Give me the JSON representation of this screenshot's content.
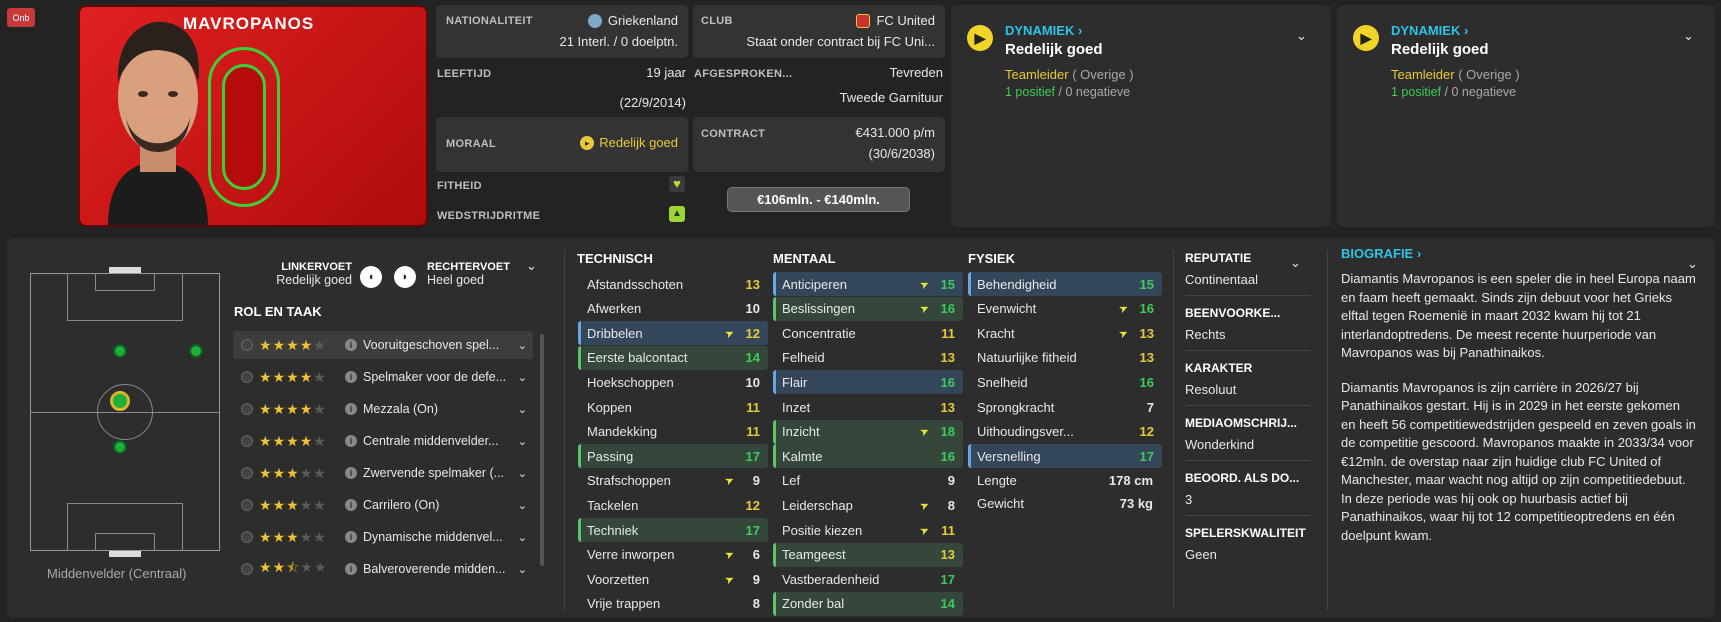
{
  "badge": "Onb",
  "player": {
    "name": "MAVROPANOS"
  },
  "info": {
    "nationality_label": "NATIONALITEIT",
    "nationality": "Griekenland",
    "caps": "21 Interl. / 0 doelptn.",
    "club_label": "CLUB",
    "club": "FC United",
    "club_status": "Staat onder contract bij FC Uni...",
    "age_label": "LEEFTIJD",
    "age": "19 jaar",
    "dob": "(22/9/2014)",
    "agreed_label": "AFGESPROKEN...",
    "agreed": "Tevreden",
    "squad_status": "Tweede Garnituur",
    "morale_label": "MORAAL",
    "morale": "Redelijk goed",
    "contract_label": "CONTRACT",
    "wage": "€431.000 p/m",
    "contract_end": "(30/6/2038)",
    "fitness_label": "FITHEID",
    "match_label": "WEDSTRIJDRITME",
    "value": "€106mln. - €140mln."
  },
  "dynamics": [
    {
      "title": "DYNAMIEK ›",
      "status": "Redelijk goed",
      "role": "Teamleider",
      "role_group": "( Overige )",
      "positive": "1 positief",
      "sep": "/",
      "negative": "0 negatieve"
    },
    {
      "title": "DYNAMIEK ›",
      "status": "Redelijk goed",
      "role": "Teamleider",
      "role_group": "( Overige )",
      "positive": "1 positief",
      "sep": "/",
      "negative": "0 negatieve"
    }
  ],
  "feet": {
    "left_label": "LINKERVOET",
    "left_value": "Redelijk goed",
    "right_label": "RECHTERVOET",
    "right_value": "Heel goed"
  },
  "roles_title": "ROL EN TAAK",
  "position_label": "Middenvelder (Centraal)",
  "roles": [
    {
      "stars": 4,
      "half": false,
      "label": "Vooruitgeschoven spel..."
    },
    {
      "stars": 4,
      "half": false,
      "label": "Spelmaker voor de defe..."
    },
    {
      "stars": 4,
      "half": false,
      "label": "Mezzala (On)"
    },
    {
      "stars": 4,
      "half": false,
      "label": "Centrale middenvelder..."
    },
    {
      "stars": 3,
      "half": false,
      "label": "Zwervende spelmaker (..."
    },
    {
      "stars": 3,
      "half": false,
      "label": "Carrilero (On)"
    },
    {
      "stars": 3,
      "half": false,
      "label": "Dynamische middenvel..."
    },
    {
      "stars": 2,
      "half": true,
      "label": "Balveroverende midden..."
    }
  ],
  "technical_title": "TECHNISCH",
  "technical": [
    {
      "name": "Afstandsschoten",
      "value": "13",
      "hl": "none",
      "arrow": false
    },
    {
      "name": "Afwerken",
      "value": "10",
      "hl": "none",
      "arrow": false
    },
    {
      "name": "Dribbelen",
      "value": "12",
      "hl": "blue",
      "arrow": true
    },
    {
      "name": "Eerste balcontact",
      "value": "14",
      "hl": "green",
      "arrow": false
    },
    {
      "name": "Hoekschoppen",
      "value": "10",
      "hl": "none",
      "arrow": false
    },
    {
      "name": "Koppen",
      "value": "11",
      "hl": "none",
      "arrow": false
    },
    {
      "name": "Mandekking",
      "value": "11",
      "hl": "none",
      "arrow": false
    },
    {
      "name": "Passing",
      "value": "17",
      "hl": "green",
      "arrow": false
    },
    {
      "name": "Strafschoppen",
      "value": "9",
      "hl": "none",
      "arrow": true
    },
    {
      "name": "Tackelen",
      "value": "12",
      "hl": "none",
      "arrow": false
    },
    {
      "name": "Techniek",
      "value": "17",
      "hl": "green",
      "arrow": false
    },
    {
      "name": "Verre inworpen",
      "value": "6",
      "hl": "none",
      "arrow": true
    },
    {
      "name": "Voorzetten",
      "value": "9",
      "hl": "none",
      "arrow": true
    },
    {
      "name": "Vrije trappen",
      "value": "8",
      "hl": "none",
      "arrow": false
    }
  ],
  "mental_title": "MENTAAL",
  "mental": [
    {
      "name": "Anticiperen",
      "value": "15",
      "hl": "blue",
      "arrow": true
    },
    {
      "name": "Beslissingen",
      "value": "16",
      "hl": "green",
      "arrow": true
    },
    {
      "name": "Concentratie",
      "value": "11",
      "hl": "none",
      "arrow": false
    },
    {
      "name": "Felheid",
      "value": "13",
      "hl": "none",
      "arrow": false
    },
    {
      "name": "Flair",
      "value": "16",
      "hl": "blue",
      "arrow": false
    },
    {
      "name": "Inzet",
      "value": "13",
      "hl": "none",
      "arrow": false
    },
    {
      "name": "Inzicht",
      "value": "18",
      "hl": "green",
      "arrow": true
    },
    {
      "name": "Kalmte",
      "value": "16",
      "hl": "green",
      "arrow": false
    },
    {
      "name": "Lef",
      "value": "9",
      "hl": "none",
      "arrow": false
    },
    {
      "name": "Leiderschap",
      "value": "8",
      "hl": "none",
      "arrow": true
    },
    {
      "name": "Positie kiezen",
      "value": "11",
      "hl": "none",
      "arrow": true
    },
    {
      "name": "Teamgeest",
      "value": "13",
      "hl": "green",
      "arrow": false
    },
    {
      "name": "Vastberadenheid",
      "value": "17",
      "hl": "none",
      "arrow": false
    },
    {
      "name": "Zonder bal",
      "value": "14",
      "hl": "green",
      "arrow": false
    }
  ],
  "physical_title": "FYSIEK",
  "physical": [
    {
      "name": "Behendigheid",
      "value": "15",
      "hl": "blue",
      "arrow": false
    },
    {
      "name": "Evenwicht",
      "value": "16",
      "hl": "none",
      "arrow": true
    },
    {
      "name": "Kracht",
      "value": "13",
      "hl": "none",
      "arrow": true
    },
    {
      "name": "Natuurlijke fitheid",
      "value": "13",
      "hl": "none",
      "arrow": false
    },
    {
      "name": "Snelheid",
      "value": "16",
      "hl": "none",
      "arrow": false
    },
    {
      "name": "Sprongkracht",
      "value": "7",
      "hl": "none",
      "arrow": false
    },
    {
      "name": "Uithoudingsver...",
      "value": "12",
      "hl": "none",
      "arrow": false
    },
    {
      "name": "Versnelling",
      "value": "17",
      "hl": "blue",
      "arrow": false
    }
  ],
  "height_label": "Lengte",
  "height": "178 cm",
  "weight_label": "Gewicht",
  "weight": "73 kg",
  "side": [
    {
      "label": "REPUTATIE",
      "value": "Continentaal"
    },
    {
      "label": "BEENVOORKE...",
      "value": "Rechts"
    },
    {
      "label": "KARAKTER",
      "value": "Resoluut"
    },
    {
      "label": "MEDIAOMSCHRIJ...",
      "value": "Wonderkind"
    },
    {
      "label": "BEOORD. ALS DO...",
      "value": "3"
    },
    {
      "label": "SPELERSKWALITEIT",
      "value": "Geen"
    }
  ],
  "bio": {
    "title": "BIOGRAFIE ›",
    "p1": "Diamantis Mavropanos is een speler die in heel Europa naam en faam heeft gemaakt. Sinds zijn debuut voor het Grieks elftal tegen Roemenië in maart 2032 kwam hij tot 21 interlandoptredens. De meest recente huurperiode van Mavropanos was bij Panathinaikos.",
    "p2": "Diamantis Mavropanos is zijn carrière in 2026/27 bij Panathinaikos gestart. Hij is in 2029 in het eerste gekomen en heeft 56 competitiewedstrijden gespeeld en zeven goals in de competitie gescoord. Mavropanos maakte in 2033/34 voor €12mln. de overstap naar zijn huidige club FC United of Manchester, maar wacht nog altijd op zijn competitiedebuut. In deze periode was hij ook op huurbasis actief bij Panathinaikos, waar hij tot 12 competitieoptredens en één doelpunt kwam."
  },
  "colors": {
    "accent": "#2ec4e8",
    "green": "#3ecb5b",
    "yellow": "#e7c93a",
    "kit_red": "#d81818"
  }
}
